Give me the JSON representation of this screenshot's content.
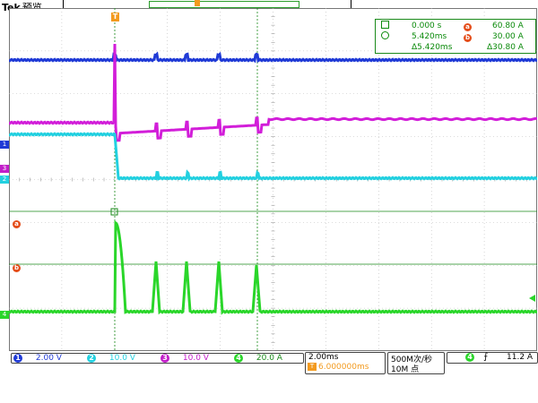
{
  "header": {
    "brand": "Tek",
    "mode": "预览",
    "trigger_marker": "T",
    "hpos_marker": "H"
  },
  "readout": {
    "time_abs": "0.000 s",
    "time_cur": "5.420ms",
    "time_delta": "Δ5.420ms",
    "a_badge": "a",
    "b_badge": "b",
    "a_val": "60.80 A",
    "b_val": "30.00 A",
    "delta_val": "Δ30.80 A"
  },
  "markers": {
    "ch1": "1",
    "ch2": "2",
    "ch3": "3",
    "ch4": "4",
    "cursor_a": "a",
    "cursor_b": "b"
  },
  "channels": [
    {
      "num": "1",
      "scale": "2.00 V",
      "color": "#1f3ad6"
    },
    {
      "num": "2",
      "scale": "10.0 V",
      "color": "#22d0e0"
    },
    {
      "num": "3",
      "scale": "10.0 V",
      "color": "#c21ec9"
    },
    {
      "num": "4",
      "scale": "20.0 A",
      "color": "#26c226"
    }
  ],
  "timebase": {
    "scale": "2.00ms",
    "position": "6.000000ms",
    "rate": "500M次/秒",
    "points": "10M 点"
  },
  "trigger": {
    "source": "4",
    "slope_icon": "rising-edge-icon",
    "level": "11.2 A"
  },
  "colors": {
    "ch1": "#1f3ad6",
    "ch2": "#22d0e0",
    "ch3": "#d21ed9",
    "ch4": "#2ad62a",
    "cursor": "#1a8a1a",
    "badge": "#e44d1a",
    "trigger": "#f39a1e"
  }
}
